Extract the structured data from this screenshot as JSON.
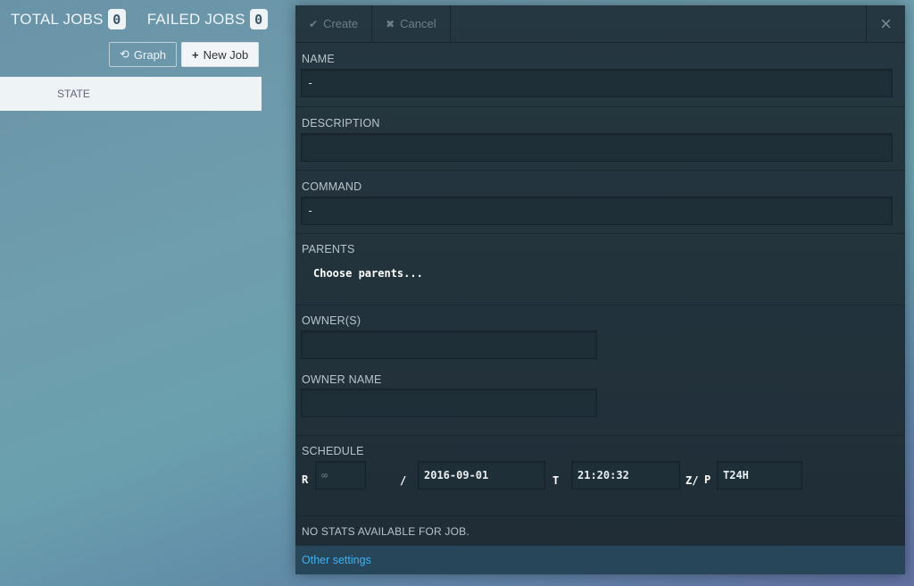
{
  "counters": {
    "total_label": "TOTAL JOBS",
    "total_value": "0",
    "failed_label": "FAILED JOBS",
    "failed_value": "0"
  },
  "toolbar": {
    "graph_label": "Graph",
    "new_job_label": "New Job"
  },
  "table": {
    "state_header": "STATE"
  },
  "modal": {
    "create_label": "Create",
    "cancel_label": "Cancel",
    "close_glyph": "×",
    "name_label": "NAME",
    "name_value": "-",
    "description_label": "DESCRIPTION",
    "description_value": "",
    "command_label": "COMMAND",
    "command_value": "-",
    "parents_label": "PARENTS",
    "parents_placeholder": "Choose parents...",
    "owners_label": "OWNER(S)",
    "owners_value": "",
    "owner_name_label": "OWNER NAME",
    "owner_name_value": "",
    "schedule_label": "SCHEDULE",
    "schedule": {
      "r_label": "R",
      "repeat_value": "∞",
      "slash": "/",
      "date_value": "2016-09-01",
      "t_label": "T",
      "time_value": "21:20:32",
      "z_label": "Z/",
      "p_label": "P",
      "period_value": "T24H"
    },
    "stats_text": "NO STATS AVAILABLE FOR JOB.",
    "other_settings_label": "Other settings"
  },
  "colors": {
    "accent_link": "#3fb1f0",
    "modal_bg": "#22323b"
  },
  "icons": {
    "graph": "refresh-icon",
    "new_job": "plus-icon",
    "create": "check-icon",
    "cancel": "x-icon",
    "close": "close-icon"
  }
}
